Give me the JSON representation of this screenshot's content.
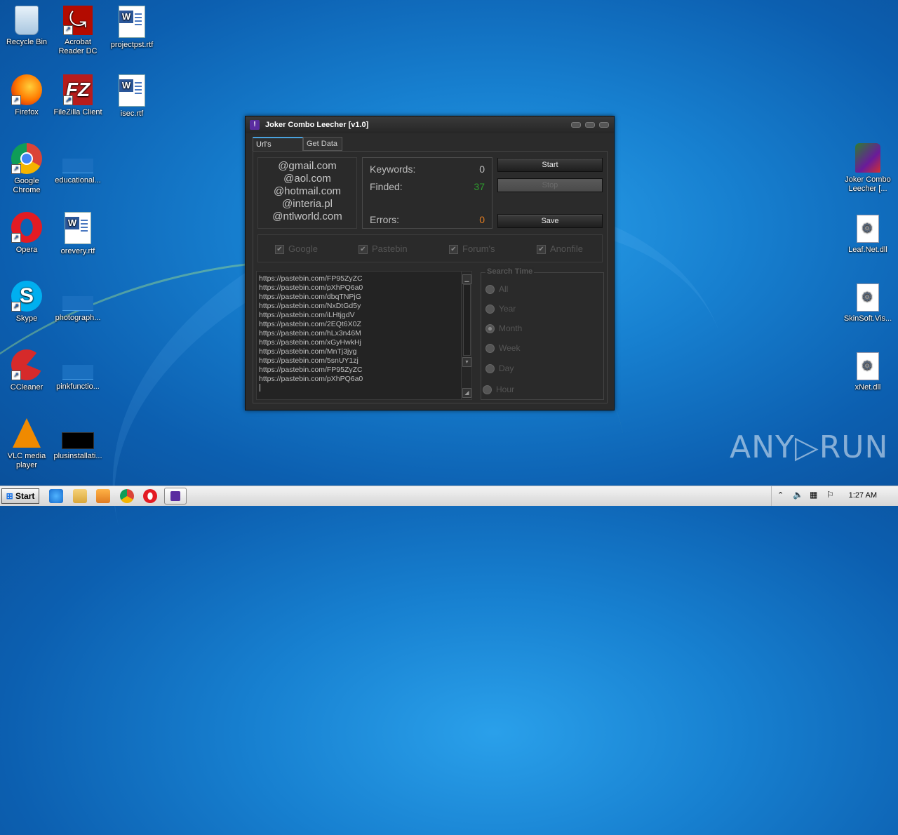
{
  "desktop": {
    "left_icons": [
      {
        "label": "Recycle Bin",
        "icon": "recycle-bin-icon"
      },
      {
        "label": "Acrobat Reader DC",
        "icon": "acrobat-icon"
      },
      {
        "label": "projectpst.rtf",
        "icon": "word-doc-icon"
      },
      {
        "label": "Firefox",
        "icon": "firefox-icon"
      },
      {
        "label": "FileZilla Client",
        "icon": "filezilla-icon"
      },
      {
        "label": "isec.rtf",
        "icon": "word-doc-icon"
      },
      {
        "label": "Google Chrome",
        "icon": "chrome-icon"
      },
      {
        "label": "educational...",
        "icon": "blank-file-icon"
      },
      {
        "label": "Opera",
        "icon": "opera-icon"
      },
      {
        "label": "orevery.rtf",
        "icon": "word-doc-icon"
      },
      {
        "label": "Skype",
        "icon": "skype-icon"
      },
      {
        "label": "photograph...",
        "icon": "blank-file-icon"
      },
      {
        "label": "CCleaner",
        "icon": "ccleaner-icon"
      },
      {
        "label": "pinkfunctio...",
        "icon": "blank-file-icon"
      },
      {
        "label": "VLC media player",
        "icon": "vlc-icon"
      },
      {
        "label": "plusinstallati...",
        "icon": "black-file-icon"
      }
    ],
    "right_icons": [
      {
        "label": "Joker Combo Leecher [...",
        "icon": "joker-icon"
      },
      {
        "label": "Leaf.Net.dll",
        "icon": "dll-icon"
      },
      {
        "label": "SkinSoft.Vis...",
        "icon": "dll-icon"
      },
      {
        "label": "xNet.dll",
        "icon": "dll-icon"
      }
    ],
    "watermark": "ANY▷RUN"
  },
  "window": {
    "title": "Joker Combo Leecher [v1.0]",
    "tabs": [
      "Url's Grabber",
      "Get Data"
    ],
    "domains": [
      "@gmail.com",
      "@aol.com",
      "@hotmail.com",
      "@interia.pl",
      "@ntlworld.com"
    ],
    "stats": {
      "keywords_label": "Keywords:",
      "keywords_value": "0",
      "finded_label": "Finded:",
      "finded_value": "37",
      "errors_label": "Errors:",
      "errors_value": "0"
    },
    "buttons": {
      "start": "Start",
      "stop": "Stop",
      "save": "Save"
    },
    "sources": [
      "Google",
      "Pastebin",
      "Forum's",
      "Anonfile"
    ],
    "urls": [
      "https://pastebin.com/FP95ZyZC",
      "https://pastebin.com/pXhPQ6a0",
      "https://pastebin.com/dbqTNPjG",
      "https://pastebin.com/NxDtGd5y",
      "https://pastebin.com/iLHtjgdV",
      "https://pastebin.com/2EQt6X0Z",
      "https://pastebin.com/hLx3n46M",
      "https://pastebin.com/xGyHwkHj",
      "https://pastebin.com/MnTj3jyg",
      "https://pastebin.com/5snUY1zj",
      "https://pastebin.com/FP95ZyZC",
      "https://pastebin.com/pXhPQ6a0"
    ],
    "search_time": {
      "legend": "Search Time",
      "options": [
        "All",
        "Year",
        "Month",
        "Week",
        "Day",
        "Hour"
      ],
      "selected": "Month"
    }
  },
  "taskbar": {
    "start_label": "Start",
    "clock": "1:27 AM",
    "pinned": [
      "ie-icon",
      "explorer-icon",
      "media-player-icon",
      "chrome-icon",
      "opera-icon",
      "joker-icon"
    ]
  },
  "colors": {
    "finded": "#2e9a2e",
    "errors": "#e07b20",
    "tab_accent": "#4aa3df"
  }
}
